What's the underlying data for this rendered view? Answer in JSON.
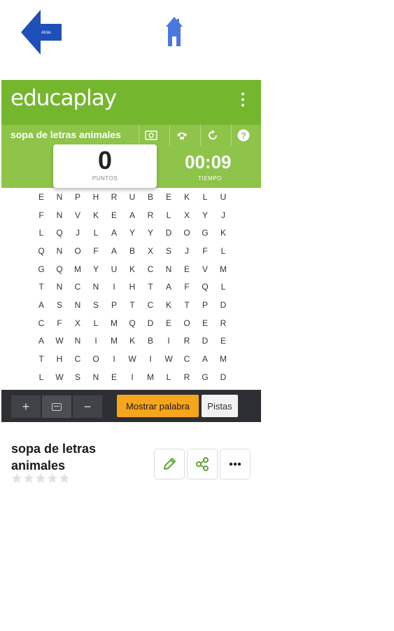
{
  "nav": {
    "back_label": "Atrás",
    "colors": {
      "arrow": "#1f4fb8",
      "home": "#4a78e0"
    }
  },
  "header": {
    "logo": "educaplay",
    "menu_icon": "kebab-icon"
  },
  "toolbar": {
    "title": "sopa de letras animales",
    "buttons": [
      "screenshot-icon",
      "phone-icon",
      "restart-icon",
      "help-icon"
    ]
  },
  "score": {
    "points": "0",
    "points_label": "PUNTOS",
    "time": "00:09",
    "time_label": "TIEMPO"
  },
  "grid": [
    [
      "E",
      "N",
      "P",
      "H",
      "R",
      "U",
      "B",
      "E",
      "K",
      "L",
      "U"
    ],
    [
      "F",
      "N",
      "V",
      "K",
      "E",
      "A",
      "R",
      "L",
      "X",
      "Y",
      "J"
    ],
    [
      "L",
      "Q",
      "J",
      "L",
      "A",
      "Y",
      "Y",
      "D",
      "O",
      "G",
      "K"
    ],
    [
      "Q",
      "N",
      "O",
      "F",
      "A",
      "B",
      "X",
      "S",
      "J",
      "F",
      "L"
    ],
    [
      "G",
      "Q",
      "M",
      "Y",
      "U",
      "K",
      "C",
      "N",
      "E",
      "V",
      "M"
    ],
    [
      "T",
      "N",
      "C",
      "N",
      "I",
      "H",
      "T",
      "A",
      "F",
      "Q",
      "L"
    ],
    [
      "A",
      "S",
      "N",
      "S",
      "P",
      "T",
      "C",
      "K",
      "T",
      "P",
      "D"
    ],
    [
      "C",
      "F",
      "X",
      "L",
      "M",
      "Q",
      "D",
      "E",
      "O",
      "E",
      "R"
    ],
    [
      "A",
      "W",
      "N",
      "I",
      "M",
      "K",
      "B",
      "I",
      "R",
      "D",
      "E"
    ],
    [
      "T",
      "H",
      "C",
      "O",
      "I",
      "W",
      "I",
      "W",
      "C",
      "A",
      "M"
    ],
    [
      "L",
      "W",
      "S",
      "N",
      "E",
      "I",
      "M",
      "L",
      "R",
      "G",
      "D"
    ]
  ],
  "bottombar": {
    "zoom_in": "+",
    "zoom_out": "−",
    "show_word": "Mostrar palabra",
    "hints": "Pistas"
  },
  "activity": {
    "title": "sopa de letras animales",
    "rating": 0,
    "rating_max": 5,
    "actions": [
      "pencil-icon",
      "share-icon",
      "more-icon"
    ]
  },
  "colors": {
    "brand_green": "#74b72e",
    "light_green": "#8dc449",
    "action_green": "#5aa832",
    "orange": "#f7a51b",
    "dark_bar": "#2d2f33"
  }
}
